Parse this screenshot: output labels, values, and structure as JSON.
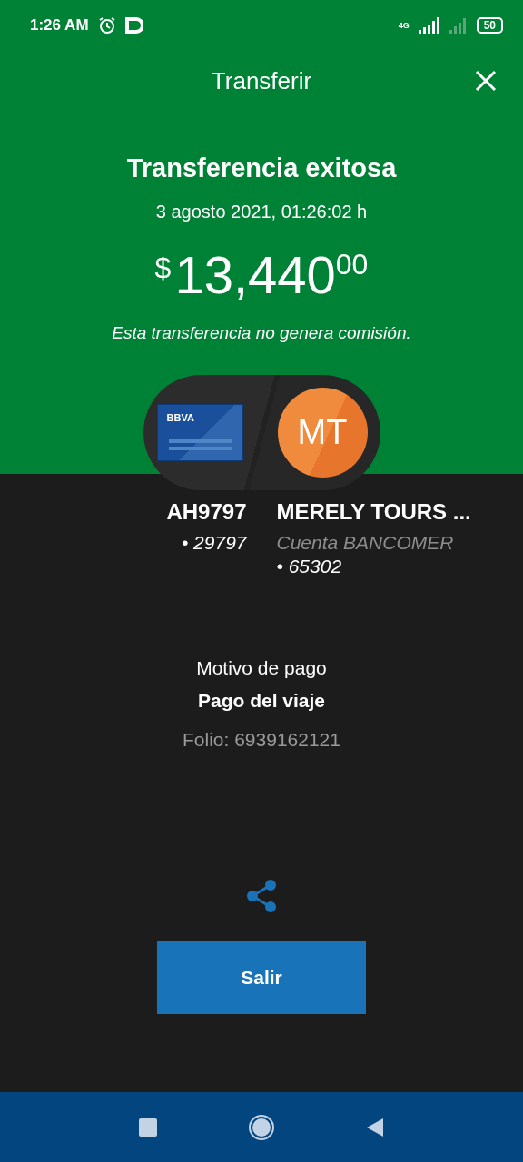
{
  "status_bar": {
    "time": "1:26 AM",
    "network": "4G",
    "battery": "50"
  },
  "header": {
    "title": "Transferir"
  },
  "result": {
    "heading": "Transferencia exitosa",
    "date": "3 agosto 2021, 01:26:02 h",
    "currency": "$",
    "amount": "13,440",
    "cents": "00",
    "note": "Esta transferencia no genera comisión."
  },
  "origin": {
    "bank_logo": "BBVA",
    "name": "AH9797",
    "account": "• 29797"
  },
  "destination": {
    "initials": "MT",
    "name": "MERELY TOURS ...",
    "bank": "Cuenta BANCOMER",
    "account": "• 65302"
  },
  "details": {
    "label": "Motivo de pago",
    "reason": "Pago del viaje",
    "folio": "Folio: 6939162121"
  },
  "buttons": [
    {
      "label": "Salir"
    }
  ]
}
